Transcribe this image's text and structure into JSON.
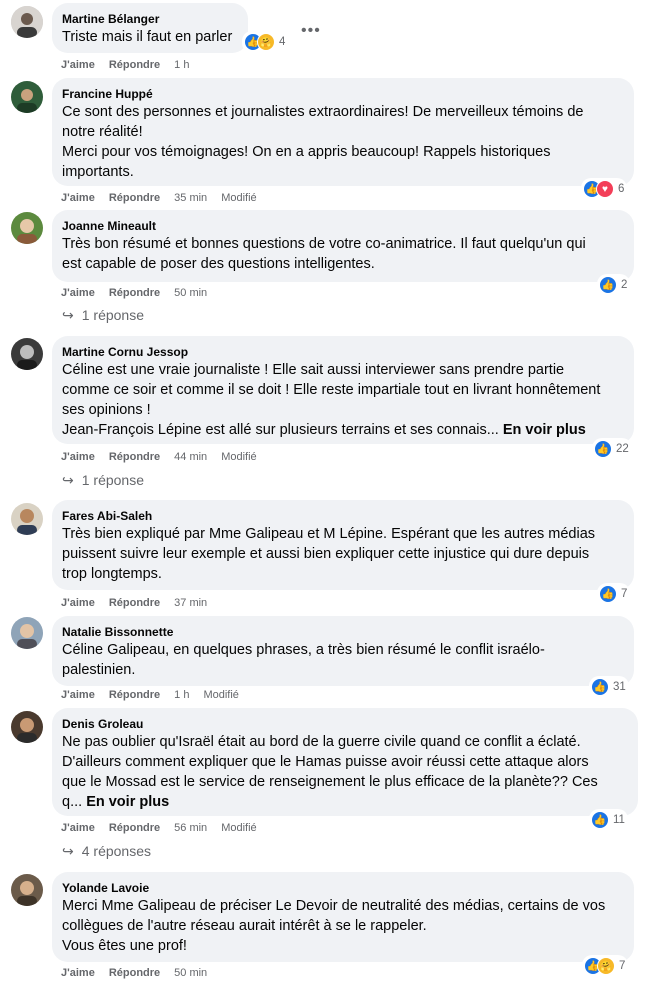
{
  "actions": {
    "like": "J'aime",
    "reply": "Répondre",
    "edited": "Modifié",
    "see_more": "En voir plus"
  },
  "comments": [
    {
      "author": "Martine Bélanger",
      "text": "Triste mais il faut en parler",
      "time": "1 h",
      "reactions": "4"
    },
    {
      "author": "Francine Huppé",
      "text": "Ce sont des personnes et journalistes extraordinaires! De merveilleux témoins de\nnotre réalité!\nMerci pour vos témoignages! On en a appris beaucoup! Rappels historiques\nimportants.",
      "time": "35 min",
      "reactions": "6"
    },
    {
      "author": "Joanne Mineault",
      "text": "Très bon résumé et bonnes questions de votre co-animatrice. Il faut quelqu'un qui\nest capable de poser des questions intelligentes.",
      "time": "50 min",
      "reactions": "2",
      "replies": "1 réponse"
    },
    {
      "author": "Martine Cornu Jessop",
      "text": "Céline est une vraie journaliste ! Elle sait aussi interviewer sans prendre partie\ncomme ce soir et comme il se doit ! Elle reste impartiale tout en livrant honnêtement\nses opinions !\nJean-François Lépine est allé sur plusieurs terrains et ses connais...",
      "time": "44 min",
      "reactions": "22",
      "replies": "1 réponse"
    },
    {
      "author": "Fares Abi-Saleh",
      "text": "Très bien expliqué par Mme Galipeau et M Lépine. Espérant que les autres médias\npuissent suivre leur exemple et aussi bien expliquer cette injustice qui dure depuis\ntrop longtemps.",
      "time": "37 min",
      "reactions": "7"
    },
    {
      "author": "Natalie Bissonnette",
      "text": "Céline Galipeau, en quelques phrases, a très bien résumé le conflit israélo-\npalestinien.",
      "time": "1 h",
      "reactions": "31"
    },
    {
      "author": "Denis Groleau",
      "text": "Ne pas oublier qu'Israël était au bord de la guerre civile quand ce conflit a éclaté.\nD'ailleurs comment expliquer que le Hamas puisse avoir réussi cette attaque alors\nque le Mossad est le service de renseignement le plus efficace de la planète?? Ces\nq...",
      "time": "56 min",
      "reactions": "11",
      "replies": "4 réponses"
    },
    {
      "author": "Yolande Lavoie",
      "text": "Merci Mme Galipeau de préciser Le Devoir de neutralité des médias, certains de vos\ncollègues de l'autre réseau aurait intérêt à se le rappeler.\nVous êtes une prof!",
      "time": "50 min",
      "reactions": "7"
    }
  ],
  "icons": {
    "like": "thumbs-up-icon",
    "love": "heart-icon",
    "care": "care-icon",
    "reply_arrow": "reply-arrow-icon",
    "more": "more-options-icon"
  },
  "colors": {
    "bubble": "#f0f2f5",
    "like": "#1b74e4",
    "love": "#f33e58",
    "care": "#f7b928",
    "meta": "#65676b"
  }
}
